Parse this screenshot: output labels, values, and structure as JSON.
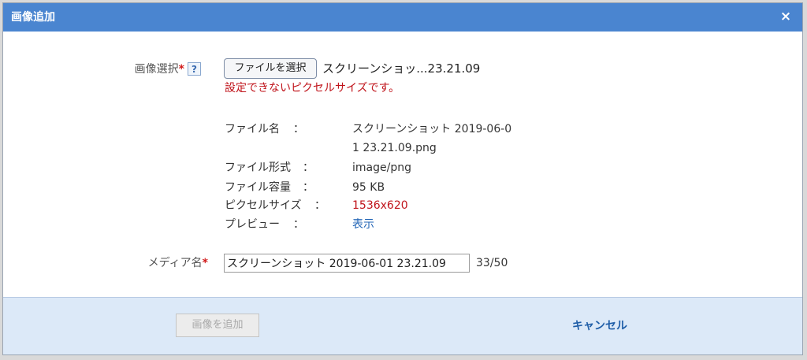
{
  "dialog": {
    "title": "画像追加",
    "close_glyph": "×"
  },
  "image_select": {
    "label": "画像選択",
    "required_mark": "*",
    "help_glyph": "?",
    "button_label": "ファイルを選択",
    "chosen_file": "スクリーンショッ...23.21.09",
    "error": "設定できないピクセルサイズです。"
  },
  "file_info": [
    {
      "label": "ファイル名",
      "colon": "：",
      "value_line1": "スクリーンショット 2019-06-0",
      "value_line2": "1 23.21.09.png"
    },
    {
      "label": "ファイル形式",
      "colon": "：",
      "value": "image/png"
    },
    {
      "label": "ファイル容量",
      "colon": "：",
      "value": "95 KB"
    },
    {
      "label": "ピクセルサイズ",
      "colon": "：",
      "value": "1536x620"
    },
    {
      "label": "プレビュー",
      "colon": "：",
      "value": "表示"
    }
  ],
  "media_name": {
    "label": "メディア名",
    "required_mark": "*",
    "value": "スクリーンショット 2019-06-01 23.21.09",
    "counter": "33/50"
  },
  "footer": {
    "add_button": "画像を追加",
    "cancel_button": "キャンセル"
  },
  "colors": {
    "titlebar": "#4a85d0",
    "error": "#c0141b",
    "link": "#1f63b5",
    "footer": "#dce9f8"
  }
}
